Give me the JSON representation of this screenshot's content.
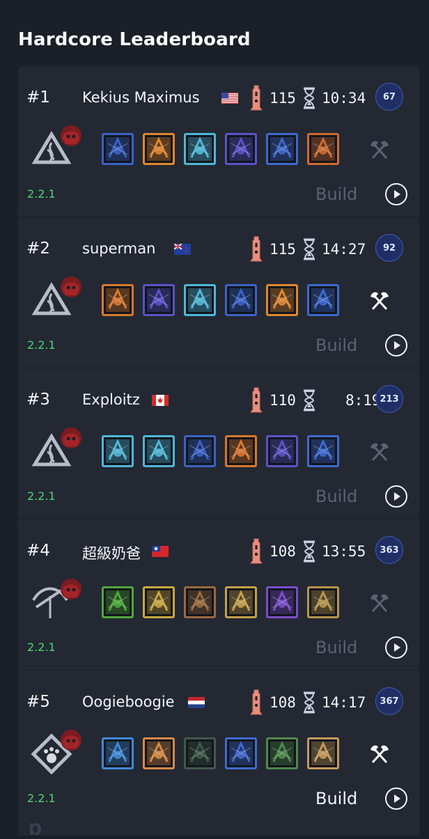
{
  "page": {
    "title": "Hardcore Leaderboard"
  },
  "entries": [
    {
      "rank": "#1",
      "name": "Kekius Maximus",
      "flag": "us",
      "level": "115",
      "time": "10:34",
      "badge": "67",
      "class": "sorcerer",
      "skills": [
        "lightning-spear-skill",
        "fire-shield-skill",
        "frost-blades-skill",
        "chain-lightning-skill",
        "vortex-skill",
        "fire-spell-skill"
      ],
      "skill_colors": [
        "#3a63c8",
        "#e0872e",
        "#4fb8d8",
        "#5c52c8",
        "#3d6ad0",
        "#cf6b2e"
      ],
      "axe_active": false,
      "version": "2.2.1",
      "build_label": "Build",
      "build_active": false
    },
    {
      "rank": "#2",
      "name": "superman",
      "flag": "nz",
      "level": "115",
      "time": "14:27",
      "badge": "92",
      "class": "sorcerer",
      "skills": [
        "fireball-skill",
        "chain-lightning-skill",
        "ice-shield-skill",
        "lightning-spear-skill",
        "fire-shield-skill",
        "vortex-skill"
      ],
      "skill_colors": [
        "#d9782c",
        "#5c52c8",
        "#4fb8d8",
        "#3a63c8",
        "#e0872e",
        "#3d6ad0"
      ],
      "axe_active": true,
      "version": "2.2.1",
      "build_label": "Build",
      "build_active": false
    },
    {
      "rank": "#3",
      "name": "Exploitz",
      "flag": "ca",
      "level": "110",
      "time": "8:19",
      "badge": "213",
      "class": "sorcerer",
      "skills": [
        "frost-blades-skill",
        "ice-shield-skill",
        "lightning-spear-skill",
        "fireball-skill",
        "chain-lightning-skill",
        "vortex-skill"
      ],
      "skill_colors": [
        "#4fb8d8",
        "#4fb8d8",
        "#3a63c8",
        "#d9782c",
        "#5c52c8",
        "#3d6ad0"
      ],
      "axe_active": false,
      "version": "2.2.1",
      "build_label": "Build",
      "build_active": false
    },
    {
      "rank": "#4",
      "name": "超級奶爸",
      "flag": "tw",
      "level": "108",
      "time": "13:55",
      "badge": "363",
      "class": "crossbow",
      "skills": [
        "poison-skull-skill",
        "starburst-skill",
        "arrow-volley-skill",
        "eye-trap-skill",
        "shadow-burst-skill",
        "dash-skill"
      ],
      "skill_colors": [
        "#4fa83a",
        "#c9a73f",
        "#9b6a3c",
        "#c7a04a",
        "#7a4fc8",
        "#b8944a"
      ],
      "axe_active": false,
      "version": "2.2.1",
      "build_label": "Build",
      "build_active": false
    },
    {
      "rank": "#5",
      "name": "Oogieboogie",
      "flag": "nl",
      "level": "108",
      "time": "14:17",
      "badge": "367",
      "class": "beast",
      "skills": [
        "cyclone-skill",
        "fire-fist-skill",
        "raven-skill",
        "lightning-storm-skill",
        "wolf-skill",
        "thorn-flower-skill"
      ],
      "skill_colors": [
        "#3f8ad8",
        "#d78a45",
        "#3f5a48",
        "#3f6ad0",
        "#4f8a4a",
        "#c49a5a"
      ],
      "axe_active": true,
      "version": "2.2.1",
      "build_label": "Build",
      "build_active": true
    }
  ]
}
